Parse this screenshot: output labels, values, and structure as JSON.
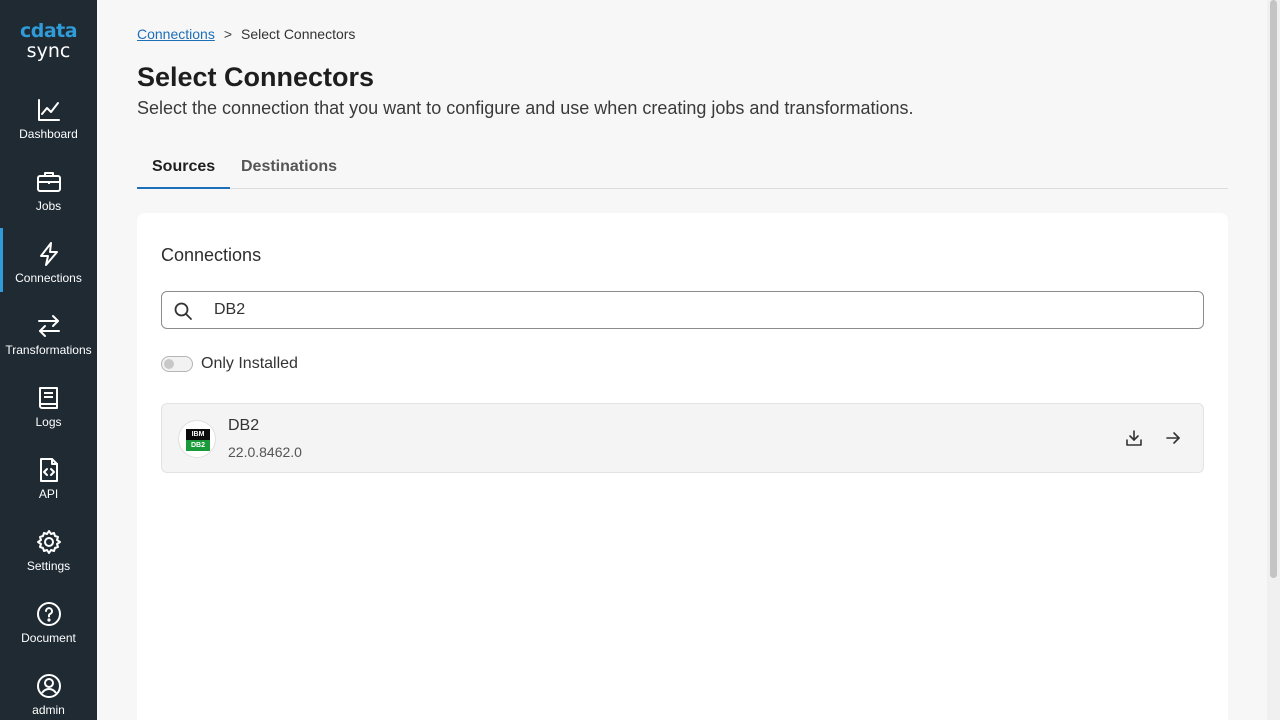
{
  "app": {
    "logo_word": "cdata",
    "logo_sub": "sync"
  },
  "sidebar": {
    "items": [
      {
        "label": "Dashboard",
        "icon": "chart-line-icon"
      },
      {
        "label": "Jobs",
        "icon": "briefcase-icon"
      },
      {
        "label": "Connections",
        "icon": "lightning-icon",
        "active": true
      },
      {
        "label": "Transformations",
        "icon": "arrows-swap-icon"
      },
      {
        "label": "Logs",
        "icon": "book-icon"
      },
      {
        "label": "API",
        "icon": "code-file-icon"
      },
      {
        "label": "Settings",
        "icon": "gear-icon"
      },
      {
        "label": "Document",
        "icon": "question-circle-icon"
      },
      {
        "label": "admin",
        "icon": "user-circle-icon"
      }
    ]
  },
  "breadcrumb": {
    "link": "Connections",
    "separator": ">",
    "current": "Select Connectors"
  },
  "page": {
    "title": "Select Connectors",
    "subtitle": "Select the connection that you want to configure and use when creating jobs and transformations."
  },
  "tabs": {
    "sources": "Sources",
    "destinations": "Destinations",
    "active": "Sources"
  },
  "connections": {
    "title": "Connections",
    "search_value": "DB2",
    "only_installed_label": "Only Installed",
    "only_installed_on": false,
    "items": [
      {
        "name": "DB2",
        "version": "22.0.8462.0",
        "logo_top": "IBM",
        "logo_bottom": "DB2"
      }
    ]
  },
  "colors": {
    "sidebar_bg": "#1f2a33",
    "accent": "#2f9bd8",
    "link": "#1d6fb8"
  }
}
